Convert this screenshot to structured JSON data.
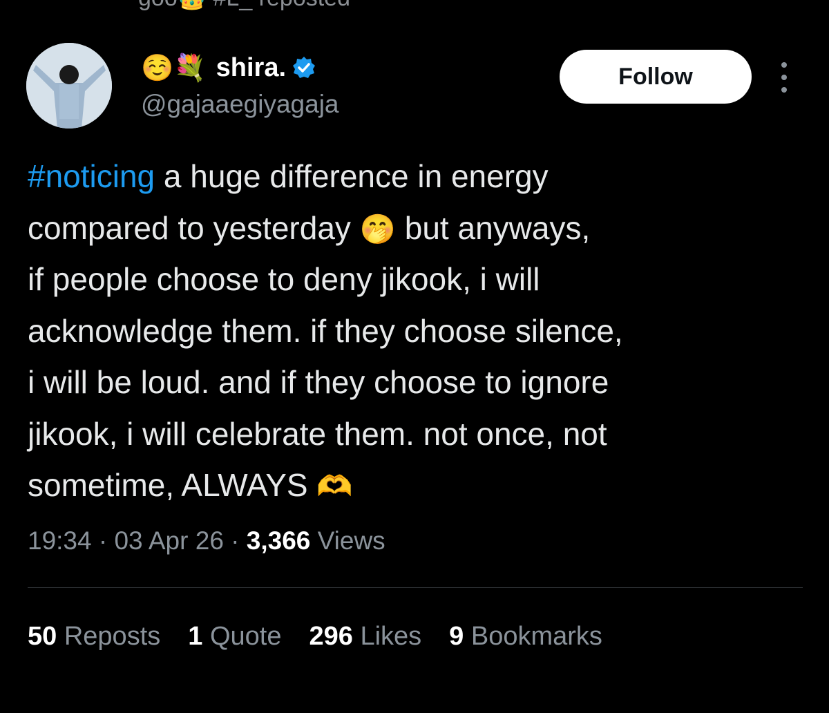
{
  "header_partial_text": "goo👑 #L_ reposted",
  "author": {
    "emojis": "☺️💐",
    "display_name": "shira.",
    "handle": "@gajaaegiyagaja"
  },
  "follow_label": "Follow",
  "tweet": {
    "hashtag": "#noticing",
    "line1_rest": " a huge difference in energy",
    "line2_pre": "compared to yesterday ",
    "line2_emoji": "🤭",
    "line2_post": " but anyways,",
    "line3": "if people choose to deny jikook, i will",
    "line4": "acknowledge them. if they choose silence,",
    "line5": "i will be loud. and if they choose to ignore",
    "line6": "jikook, i will celebrate them. not once, not",
    "line7_text": "sometime, ALWAYS ",
    "line7_emoji": "🫶"
  },
  "meta": {
    "time": "19:34",
    "date": "03 Apr 26",
    "views_count": "3,366",
    "views_label": "Views",
    "sep": " · "
  },
  "stats": {
    "reposts_count": "50",
    "reposts_label": "Reposts",
    "quotes_count": "1",
    "quotes_label": "Quote",
    "likes_count": "296",
    "likes_label": "Likes",
    "bookmarks_count": "9",
    "bookmarks_label": "Bookmarks"
  }
}
